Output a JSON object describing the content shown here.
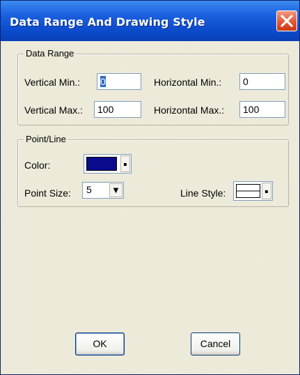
{
  "window": {
    "title": "Data Range And Drawing Style"
  },
  "data_range": {
    "group_title": "Data Range",
    "vertical_min_label": "Vertical Min.:",
    "vertical_min_value": "0",
    "vertical_max_label": "Vertical Max.:",
    "vertical_max_value": "100",
    "horizontal_min_label": "Horizontal Min.:",
    "horizontal_min_value": "0",
    "horizontal_max_label": "Horizontal Max.:",
    "horizontal_max_value": "100"
  },
  "point_line": {
    "group_title": "Point/Line",
    "color_label": "Color:",
    "color_value": "#0a0a8c",
    "point_size_label": "Point Size:",
    "point_size_value": "5",
    "line_style_label": "Line Style:"
  },
  "buttons": {
    "ok": "OK",
    "cancel": "Cancel"
  }
}
